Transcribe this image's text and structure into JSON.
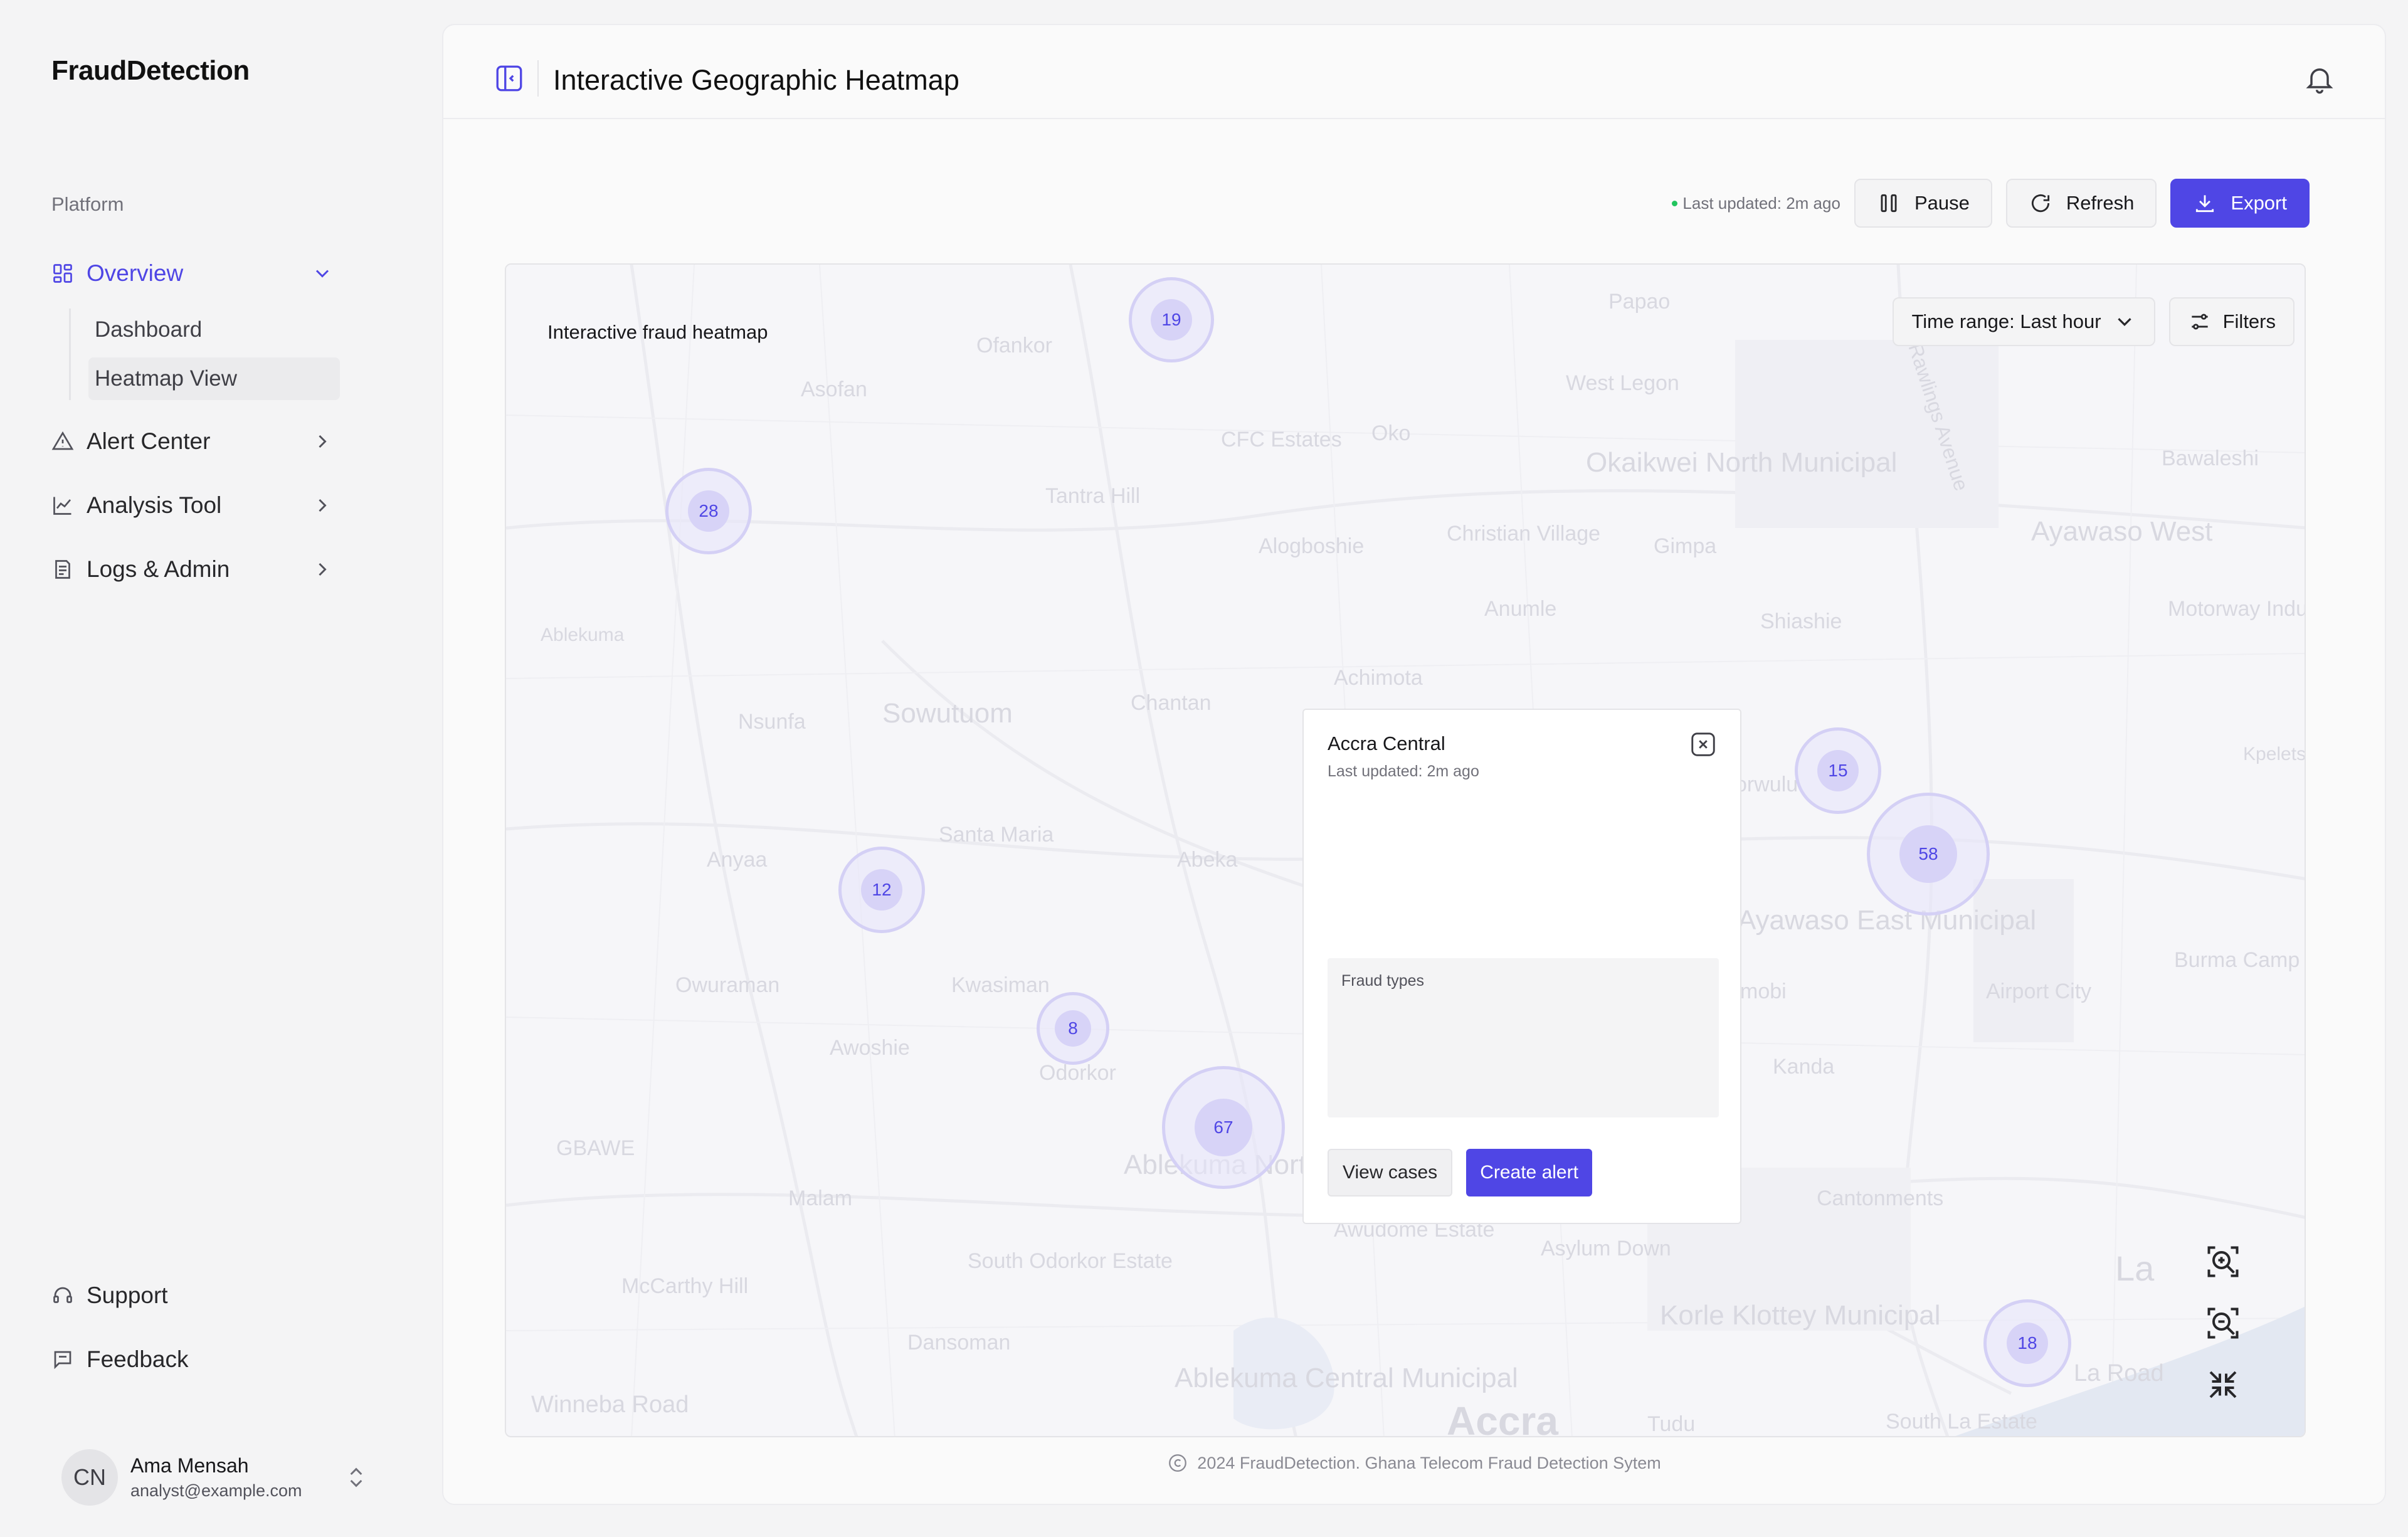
{
  "app": {
    "brand": "FraudDetection"
  },
  "sidebar": {
    "section_label": "Platform",
    "items": [
      {
        "label": "Overview",
        "icon": "dashboard-grid-icon",
        "active": true,
        "expanded": true,
        "children": [
          {
            "label": "Dashboard"
          },
          {
            "label": "Heatmap View",
            "selected": true
          }
        ]
      },
      {
        "label": "Alert Center",
        "icon": "alert-triangle-icon"
      },
      {
        "label": "Analysis Tool",
        "icon": "line-chart-icon"
      },
      {
        "label": "Logs & Admin",
        "icon": "document-icon"
      }
    ],
    "bottom": [
      {
        "label": "Support",
        "icon": "headset-icon"
      },
      {
        "label": "Feedback",
        "icon": "message-icon"
      }
    ],
    "user": {
      "initials": "CN",
      "name": "Ama Mensah",
      "email": "analyst@example.com"
    }
  },
  "header": {
    "title": "Interactive Geographic Heatmap"
  },
  "toolbar": {
    "last_updated": "Last updated: 2m ago",
    "pause_label": "Pause",
    "refresh_label": "Refresh",
    "export_label": "Export"
  },
  "map": {
    "label": "Interactive fraud heatmap",
    "time_range_label": "Time range: Last hour",
    "filters_label": "Filters",
    "place_names": [
      "Papao",
      "Ofankor",
      "Asofan",
      "CFC Estates",
      "Oko",
      "West Legon",
      "Okaikwei North Municipal",
      "Bawaleshi",
      "Tantra Hill",
      "Alogboshie",
      "Christian Village",
      "Gimpa",
      "Ayawaso West",
      "Anumle",
      "Shiashie",
      "Motorway Indust",
      "Ablekuma",
      "Achimota",
      "Sowutuom",
      "Nsunfa",
      "Chantan",
      "Kpelets",
      "orwulu",
      "Santa Maria",
      "Anyaa",
      "Abeka",
      "Ayawaso East Municipal",
      "Burma Camp",
      "Airport City",
      "mobi",
      "Owuraman",
      "Kwasiman",
      "Awoshie",
      "Odorkor",
      "Kanda",
      "GBAWE",
      "Ablekuma North",
      "Malam",
      "Cantonments",
      "Awudome Estate",
      "South Odorkor Estate",
      "Asylum Down",
      "La",
      "McCarthy Hill",
      "Korle Klottey Municipal",
      "Dansoman",
      "Ablekuma Central Municipal",
      "Winneba Road",
      "Accra",
      "Tudu",
      "La Road",
      "South La Estate",
      "Rawlings Avenue"
    ],
    "clusters": [
      19,
      28,
      15,
      12,
      58,
      8,
      67,
      18
    ]
  },
  "popup": {
    "title": "Accra Central",
    "subtitle": "Last updated: 2m ago",
    "fraud_types_label": "Fraud types",
    "view_cases_label": "View cases",
    "create_alert_label": "Create alert"
  },
  "footer": {
    "text": "2024 FraudDetection. Ghana Telecom Fraud Detection Sytem"
  },
  "colors": {
    "accent": "#4f46e5",
    "cluster_fill": "#d7d3f7",
    "status_dot": "#22c55e"
  }
}
